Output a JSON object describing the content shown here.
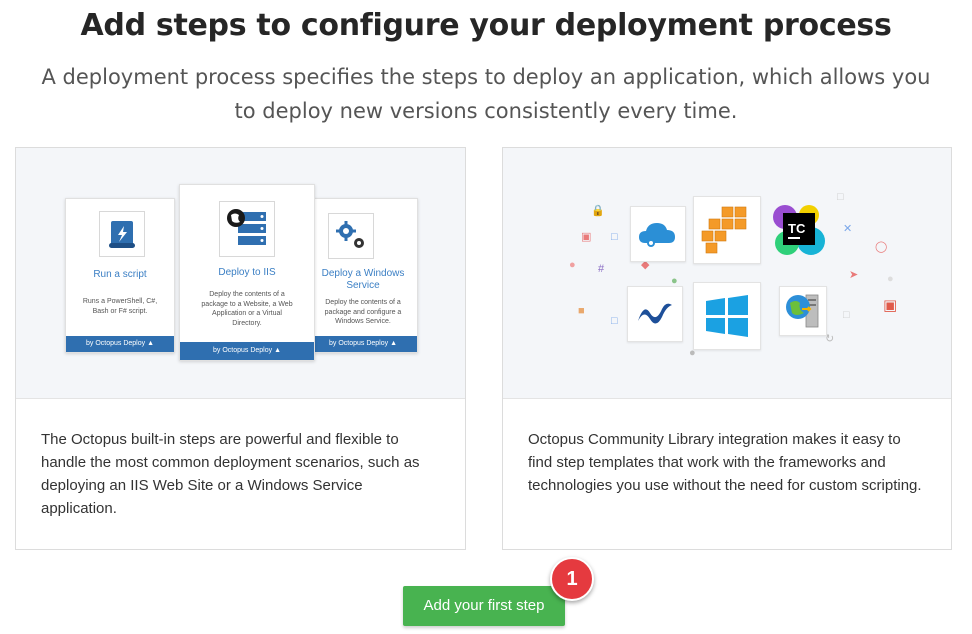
{
  "header": {
    "title": "Add steps to configure your deployment process",
    "subtitle": "A deployment process specifies the steps to deploy an application, which allows you to deploy new versions consistently every time."
  },
  "builtin_card": {
    "steps": [
      {
        "title": "Run a script",
        "description": "Runs a PowerShell, C#, Bash or F# script.",
        "footer": "by Octopus Deploy",
        "icon": "script-scroll-icon"
      },
      {
        "title": "Deploy to IIS",
        "description": "Deploy the contents of a package to a Website, a Web Application or a Virtual Directory.",
        "footer": "by Octopus Deploy",
        "icon": "iis-server-icon"
      },
      {
        "title": "Deploy a Windows Service",
        "description": "Deploy the contents of a package and configure a Windows Service.",
        "footer": "by Octopus Deploy",
        "icon": "gears-icon"
      }
    ],
    "description": "The Octopus built-in steps are powerful and flexible to handle the most common deployment scenarios, such as deploying an IIS Web Site or a Windows Service application."
  },
  "community_card": {
    "logos": [
      {
        "icon": "azure-cloud-icon",
        "label": ""
      },
      {
        "icon": "aws-boxes-icon",
        "label": ""
      },
      {
        "icon": "teamcity-icon",
        "label": "TC"
      },
      {
        "icon": "dotnet-icon",
        "label": ""
      },
      {
        "icon": "windows-icon",
        "label": ""
      },
      {
        "icon": "web-server-globe-icon",
        "label": ""
      }
    ],
    "description": "Octopus Community Library integration makes it easy to find step templates that work with the frameworks and technologies you use without the need for custom scripting."
  },
  "cta": {
    "label": "Add your first step",
    "badge": "1"
  },
  "colors": {
    "primary_blue": "#2f6fb0",
    "cta_green": "#48b350",
    "badge_red": "#e53a3f"
  }
}
